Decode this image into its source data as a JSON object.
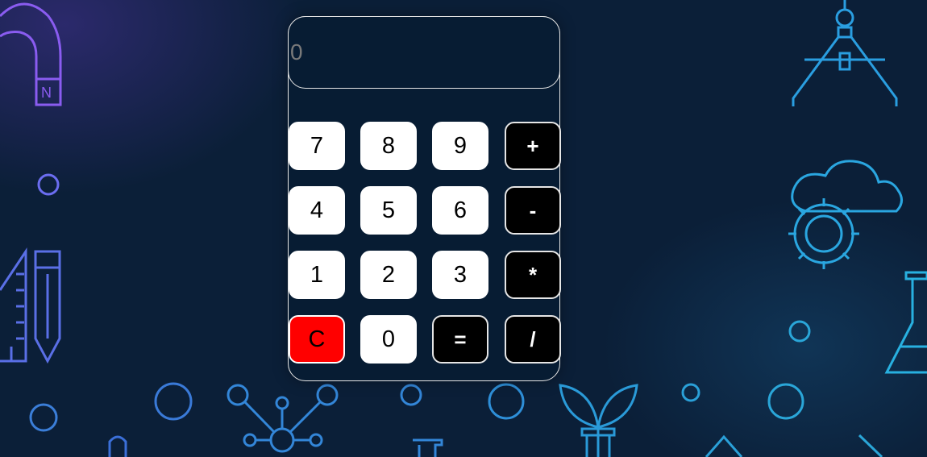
{
  "display": {
    "placeholder": "0",
    "value": ""
  },
  "keys": {
    "seven": "7",
    "eight": "8",
    "nine": "9",
    "plus": "+",
    "four": "4",
    "five": "5",
    "six": "6",
    "minus": "-",
    "one": "1",
    "two": "2",
    "three": "3",
    "multiply": "*",
    "clear": "C",
    "zero": "0",
    "equals": "=",
    "divide": "/"
  },
  "background_icons": {
    "magnet_label": "N"
  },
  "colors": {
    "background": "#0b1f38",
    "calculator_body": "#071c33",
    "digit_key": "#ffffff",
    "operator_key": "#000000",
    "clear_key": "#ff0000",
    "icon_purple": "#7b5cff",
    "icon_blue": "#2e8fd8"
  }
}
